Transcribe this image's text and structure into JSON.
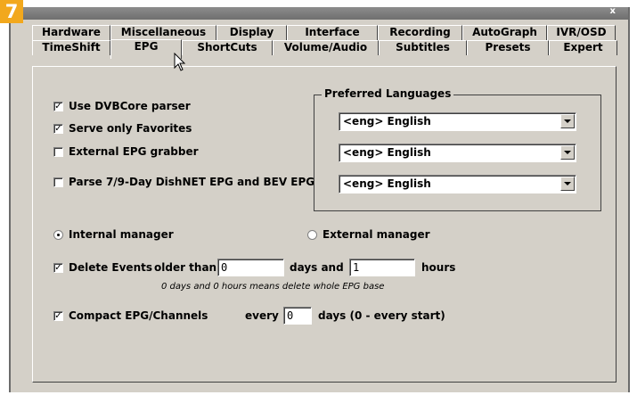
{
  "badge": "7",
  "tabs_row1": [
    "Hardware",
    "Miscellaneous",
    "Display",
    "Interface",
    "Recording",
    "AutoGraph",
    "IVR/OSD"
  ],
  "tabs_row2": [
    "TimeShift",
    "EPG",
    "ShortCuts",
    "Volume/Audio",
    "Subtitles",
    "Presets",
    "Expert"
  ],
  "active_tab": "EPG",
  "options": {
    "use_dvbcore": {
      "label": "Use DVBCore parser",
      "checked": true
    },
    "serve_favorites": {
      "label": "Serve only Favorites",
      "checked": true
    },
    "external_grabber": {
      "label": "External EPG grabber",
      "checked": false
    },
    "parse_dishnet": {
      "label": "Parse 7/9-Day DishNET EPG and BEV EPG",
      "checked": false
    }
  },
  "languages": {
    "title": "Preferred Languages",
    "selected": [
      "<eng> English",
      "<eng> English",
      "<eng> English"
    ]
  },
  "manager": {
    "internal_label": "Internal manager",
    "external_label": "External manager",
    "selected": "internal"
  },
  "delete_events": {
    "label": "Delete Events",
    "checked": true,
    "older_than_label": "older than",
    "days_value": "0",
    "days_and_label": "days and",
    "hours_value": "1",
    "hours_label": "hours",
    "note": "0 days and 0 hours means delete whole EPG base"
  },
  "compact": {
    "label": "Compact EPG/Channels",
    "checked": true,
    "every_label": "every",
    "value": "0",
    "suffix": "days (0 - every start)"
  },
  "close_glyph": "x",
  "colors": {
    "accent": "#f2a81d",
    "face": "#d4d0c8"
  }
}
